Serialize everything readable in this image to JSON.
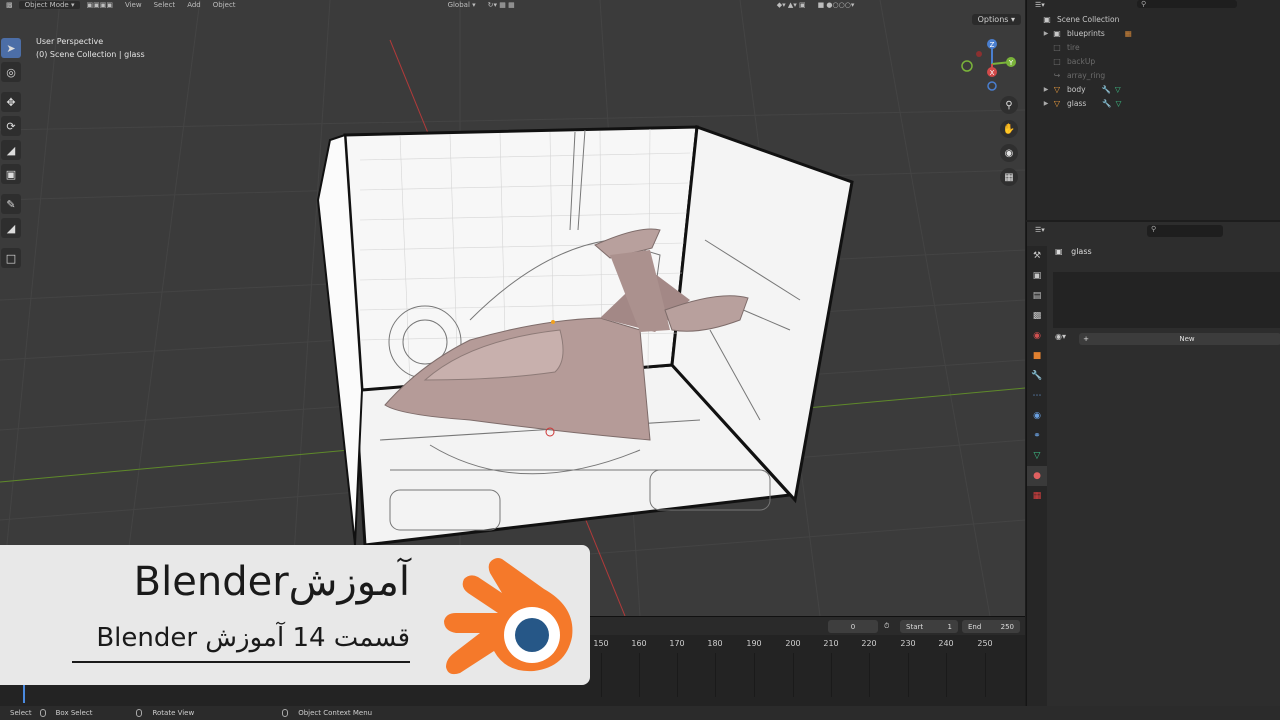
{
  "viewport": {
    "header": {
      "mode": "Object Mode",
      "menus": [
        "View",
        "Select",
        "Add",
        "Object"
      ],
      "orientation": "Global",
      "options": "Options"
    },
    "info_line1": "User Perspective",
    "info_line2": "(0) Scene Collection | glass",
    "gizmo": {
      "x": "X",
      "y": "Y",
      "z": "Z"
    }
  },
  "timeline": {
    "current_frame": "0",
    "start_label": "Start",
    "start_value": "1",
    "end_label": "End",
    "end_value": "250",
    "ticks": [
      "150",
      "160",
      "170",
      "180",
      "190",
      "200",
      "210",
      "220",
      "230",
      "240",
      "250"
    ]
  },
  "statusbar": {
    "select": "Select",
    "box_select": "Box Select",
    "rotate_view": "Rotate View",
    "context_menu": "Object Context Menu"
  },
  "outliner": {
    "root": "Scene Collection",
    "items": [
      {
        "label": "blueprints",
        "dim": false
      },
      {
        "label": "tire",
        "dim": true
      },
      {
        "label": "backUp",
        "dim": true
      },
      {
        "label": "array_ring",
        "dim": true
      },
      {
        "label": "body",
        "dim": false
      },
      {
        "label": "glass",
        "dim": false
      }
    ]
  },
  "properties": {
    "object_name": "glass",
    "new_button": "New"
  },
  "banner": {
    "title": "آموزشBlender",
    "subtitle": "قسمت 14 آموزش Blender"
  },
  "colors": {
    "accent_blue": "#4c6ea7",
    "logo_orange": "#f5792a",
    "logo_blue": "#265787",
    "axis_red": "#b03a3a",
    "axis_green": "#5f8a2a"
  }
}
